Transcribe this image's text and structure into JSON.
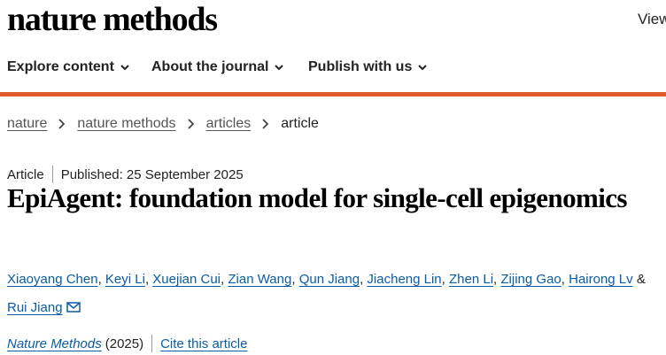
{
  "header": {
    "logo": "nature methods",
    "view_link": "View"
  },
  "nav": {
    "items": [
      {
        "label": "Explore content"
      },
      {
        "label": "About the journal"
      },
      {
        "label": "Publish with us"
      }
    ]
  },
  "accent_color": "#e05c2a",
  "breadcrumb": {
    "items": [
      "nature",
      "nature methods",
      "articles"
    ],
    "current": "article"
  },
  "article": {
    "type": "Article",
    "published": "Published: 25 September 2025",
    "title": "EpiAgent: foundation model for single-cell epigenomics",
    "authors": [
      "Xiaoyang Chen",
      "Keyi Li",
      "Xuejian Cui",
      "Zian Wang",
      "Qun Jiang",
      "Jiacheng Lin",
      "Zhen Li",
      "Zijing Gao",
      "Hairong Lv",
      "Rui Jiang"
    ],
    "author_separator": ",",
    "author_final_separator": "&",
    "journal": "Nature Methods",
    "year": "(2025)",
    "cite_label": "Cite this article"
  },
  "icons": {
    "nav_chevron": "chevron-down-icon",
    "breadcrumb_separator": "chevron-right-icon",
    "corresponding_author": "mail-icon"
  }
}
